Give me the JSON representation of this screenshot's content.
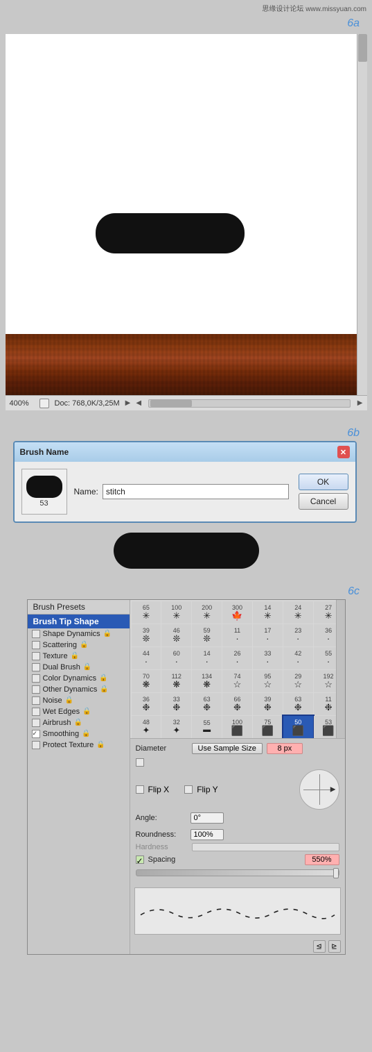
{
  "watermark": {
    "text": "思缘设计论坛 www.missyuan.com"
  },
  "section6a": {
    "label": "6a"
  },
  "canvas": {
    "zoom": "400%",
    "doc": "Doc: 768,0K/3,25M"
  },
  "section6b": {
    "label": "6b"
  },
  "dialog": {
    "title": "Brush Name",
    "name_label": "Name:",
    "name_value": "stitch",
    "brush_num": "53",
    "ok_label": "OK",
    "cancel_label": "Cancel"
  },
  "section6c": {
    "label": "6c"
  },
  "brush_panel": {
    "presets_label": "Brush Presets",
    "selected_item": "Brush Tip Shape",
    "sidebar_items": [
      {
        "label": "Shape Dynamics",
        "checked": false,
        "has_lock": true
      },
      {
        "label": "Scattering",
        "checked": false,
        "has_lock": true
      },
      {
        "label": "Texture",
        "checked": false,
        "has_lock": true
      },
      {
        "label": "Dual Brush",
        "checked": false,
        "has_lock": true
      },
      {
        "label": "Color Dynamics",
        "checked": false,
        "has_lock": true
      },
      {
        "label": "Other Dynamics",
        "checked": false,
        "has_lock": true
      },
      {
        "label": "Noise",
        "checked": false,
        "has_lock": true
      },
      {
        "label": "Wet Edges",
        "checked": false,
        "has_lock": true
      },
      {
        "label": "Airbrush",
        "checked": false,
        "has_lock": true
      },
      {
        "label": "Smoothing",
        "checked": true,
        "has_lock": true
      },
      {
        "label": "Protect Texture",
        "checked": false,
        "has_lock": true
      }
    ],
    "brush_sizes": [
      {
        "num": "65",
        "icon": "✳"
      },
      {
        "num": "100",
        "icon": "✳"
      },
      {
        "num": "200",
        "icon": "✳"
      },
      {
        "num": "300",
        "icon": "✳"
      },
      {
        "num": "14",
        "icon": "✳"
      },
      {
        "num": "24",
        "icon": "✳"
      },
      {
        "num": "27",
        "icon": "✳"
      },
      {
        "num": "39",
        "icon": "✦"
      },
      {
        "num": "46",
        "icon": "✦"
      },
      {
        "num": "59",
        "icon": "✦"
      },
      {
        "num": "11",
        "icon": "·"
      },
      {
        "num": "17",
        "icon": "·"
      },
      {
        "num": "23",
        "icon": "·"
      },
      {
        "num": "36",
        "icon": "·"
      },
      {
        "num": "44",
        "icon": "·"
      },
      {
        "num": "60",
        "icon": "·"
      },
      {
        "num": "14",
        "icon": "·"
      },
      {
        "num": "26",
        "icon": "·"
      },
      {
        "num": "33",
        "icon": "·"
      },
      {
        "num": "42",
        "icon": "·"
      },
      {
        "num": "55",
        "icon": "·"
      },
      {
        "num": "70",
        "icon": "❋"
      },
      {
        "num": "112",
        "icon": "❋"
      },
      {
        "num": "134",
        "icon": "❋"
      },
      {
        "num": "74",
        "icon": "☆"
      },
      {
        "num": "95",
        "icon": "☆"
      },
      {
        "num": "29",
        "icon": "☆"
      },
      {
        "num": "192",
        "icon": "☆"
      },
      {
        "num": "36",
        "icon": "❉"
      },
      {
        "num": "33",
        "icon": "❉"
      },
      {
        "num": "63",
        "icon": "❉"
      },
      {
        "num": "66",
        "icon": "❉"
      },
      {
        "num": "39",
        "icon": "❉"
      },
      {
        "num": "63",
        "icon": "❉"
      },
      {
        "num": "11",
        "icon": "❉"
      },
      {
        "num": "48",
        "icon": "✦"
      },
      {
        "num": "32",
        "icon": "✦"
      },
      {
        "num": "55",
        "icon": "■"
      },
      {
        "num": "100",
        "icon": "■"
      },
      {
        "num": "75",
        "icon": "■"
      },
      {
        "num": "50",
        "icon": "■"
      },
      {
        "num": "53",
        "icon": "■"
      }
    ],
    "diameter_label": "Diameter",
    "use_sample_size_label": "Use Sample Size",
    "diameter_value": "8 px",
    "flip_x_label": "Flip X",
    "flip_y_label": "Flip Y",
    "angle_label": "Angle:",
    "angle_value": "0°",
    "roundness_label": "Roundness:",
    "roundness_value": "100%",
    "hardness_label": "Hardness",
    "spacing_label": "Spacing",
    "spacing_value": "550%",
    "spacing_checked": true
  }
}
